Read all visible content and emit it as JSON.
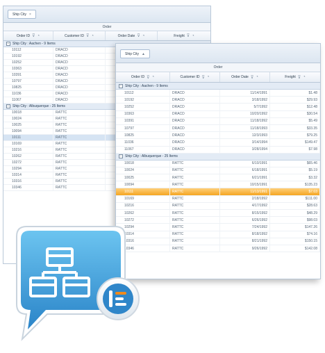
{
  "back_grid": {
    "group_chip": "Ship City",
    "band": "Order",
    "columns": [
      "Order ID",
      "Customer ID",
      "Order Date",
      "Freight"
    ],
    "groups": [
      {
        "label": "Ship City : Aachen - 9 Items",
        "rows": [
          [
            "10112",
            "DRACD"
          ],
          [
            "10192",
            "DRACD"
          ],
          [
            "10252",
            "DRACD"
          ],
          [
            "10363",
            "DRACD"
          ],
          [
            "10391",
            "DRACD"
          ],
          [
            "10797",
            "DRACD"
          ],
          [
            "10825",
            "DRACD"
          ],
          [
            "11036",
            "DRACD"
          ],
          [
            "11067",
            "DRACD"
          ]
        ]
      },
      {
        "label": "Ship City : Albuquerque - 25 Items",
        "rows": [
          [
            "10018",
            "RATTC"
          ],
          [
            "10024",
            "RATTC"
          ],
          [
            "10025",
            "RATTC"
          ],
          [
            "10094",
            "RATTC"
          ],
          [
            "10111",
            "RATTC"
          ],
          [
            "10169",
            "RATTC"
          ],
          [
            "10216",
            "RATTC"
          ],
          [
            "10262",
            "RATTC"
          ],
          [
            "10272",
            "RATTC"
          ],
          [
            "10294",
            "RATTC"
          ],
          [
            "10314",
            "RATTC"
          ],
          [
            "10316",
            "RATTC"
          ],
          [
            "10346",
            "RATTC"
          ]
        ]
      }
    ]
  },
  "front_grid": {
    "group_chip": "Ship City",
    "band": "Order",
    "columns": [
      "Order ID",
      "Customer ID",
      "Order Date",
      "Freight"
    ],
    "groups": [
      {
        "label": "Ship City : Aachen - 9 Items",
        "rows": [
          [
            "10112",
            "DRACD",
            "11/14/1991",
            "$1.48"
          ],
          [
            "10192",
            "DRACD",
            "3/18/1992",
            "$29.93"
          ],
          [
            "10252",
            "DRACD",
            "5/7/1992",
            "$12.48"
          ],
          [
            "10363",
            "DRACD",
            "10/20/1992",
            "$30.54"
          ],
          [
            "10391",
            "DRACD",
            "11/18/1992",
            "$5.49"
          ],
          [
            "10797",
            "DRACD",
            "11/18/1993",
            "$33.35"
          ],
          [
            "10825",
            "DRACD",
            "12/3/1993",
            "$79.25"
          ],
          [
            "11036",
            "DRACD",
            "3/14/1994",
            "$149.47"
          ],
          [
            "11067",
            "DRACD",
            "3/28/1994",
            "$7.98"
          ]
        ]
      },
      {
        "label": "Ship City : Albuquerque - 25 Items",
        "rows": [
          [
            "10018",
            "RATTC",
            "6/10/1991",
            "$65.46"
          ],
          [
            "10024",
            "RATTC",
            "6/18/1991",
            "$5.19"
          ],
          [
            "10025",
            "RATTC",
            "6/21/1991",
            "$3.32"
          ],
          [
            "10094",
            "RATTC",
            "10/15/1991",
            "$135.23"
          ],
          [
            "10111",
            "RATTC",
            "11/13/1991",
            "$7.03"
          ],
          [
            "10169",
            "RATTC",
            "2/18/1992",
            "$111.00"
          ],
          [
            "10216",
            "RATTC",
            "4/17/1992",
            "$28.63"
          ],
          [
            "10262",
            "RATTC",
            "8/15/1992",
            "$48.29"
          ],
          [
            "10272",
            "RATTC",
            "6/26/1992",
            "$98.03"
          ],
          [
            "10294",
            "RATTC",
            "7/24/1992",
            "$147.26"
          ],
          [
            "10314",
            "RATTC",
            "8/18/1992",
            "$74.16"
          ],
          [
            "10316",
            "RATTC",
            "8/21/1992",
            "$150.15"
          ],
          [
            "10346",
            "RATTC",
            "9/26/1992",
            "$142.08"
          ]
        ]
      }
    ]
  },
  "colors": {
    "selected_front": "#f5a623",
    "selected_back": "#d6e4f3",
    "logo_blue": "#3a9bdc",
    "logo_orange": "#f08a1c"
  }
}
